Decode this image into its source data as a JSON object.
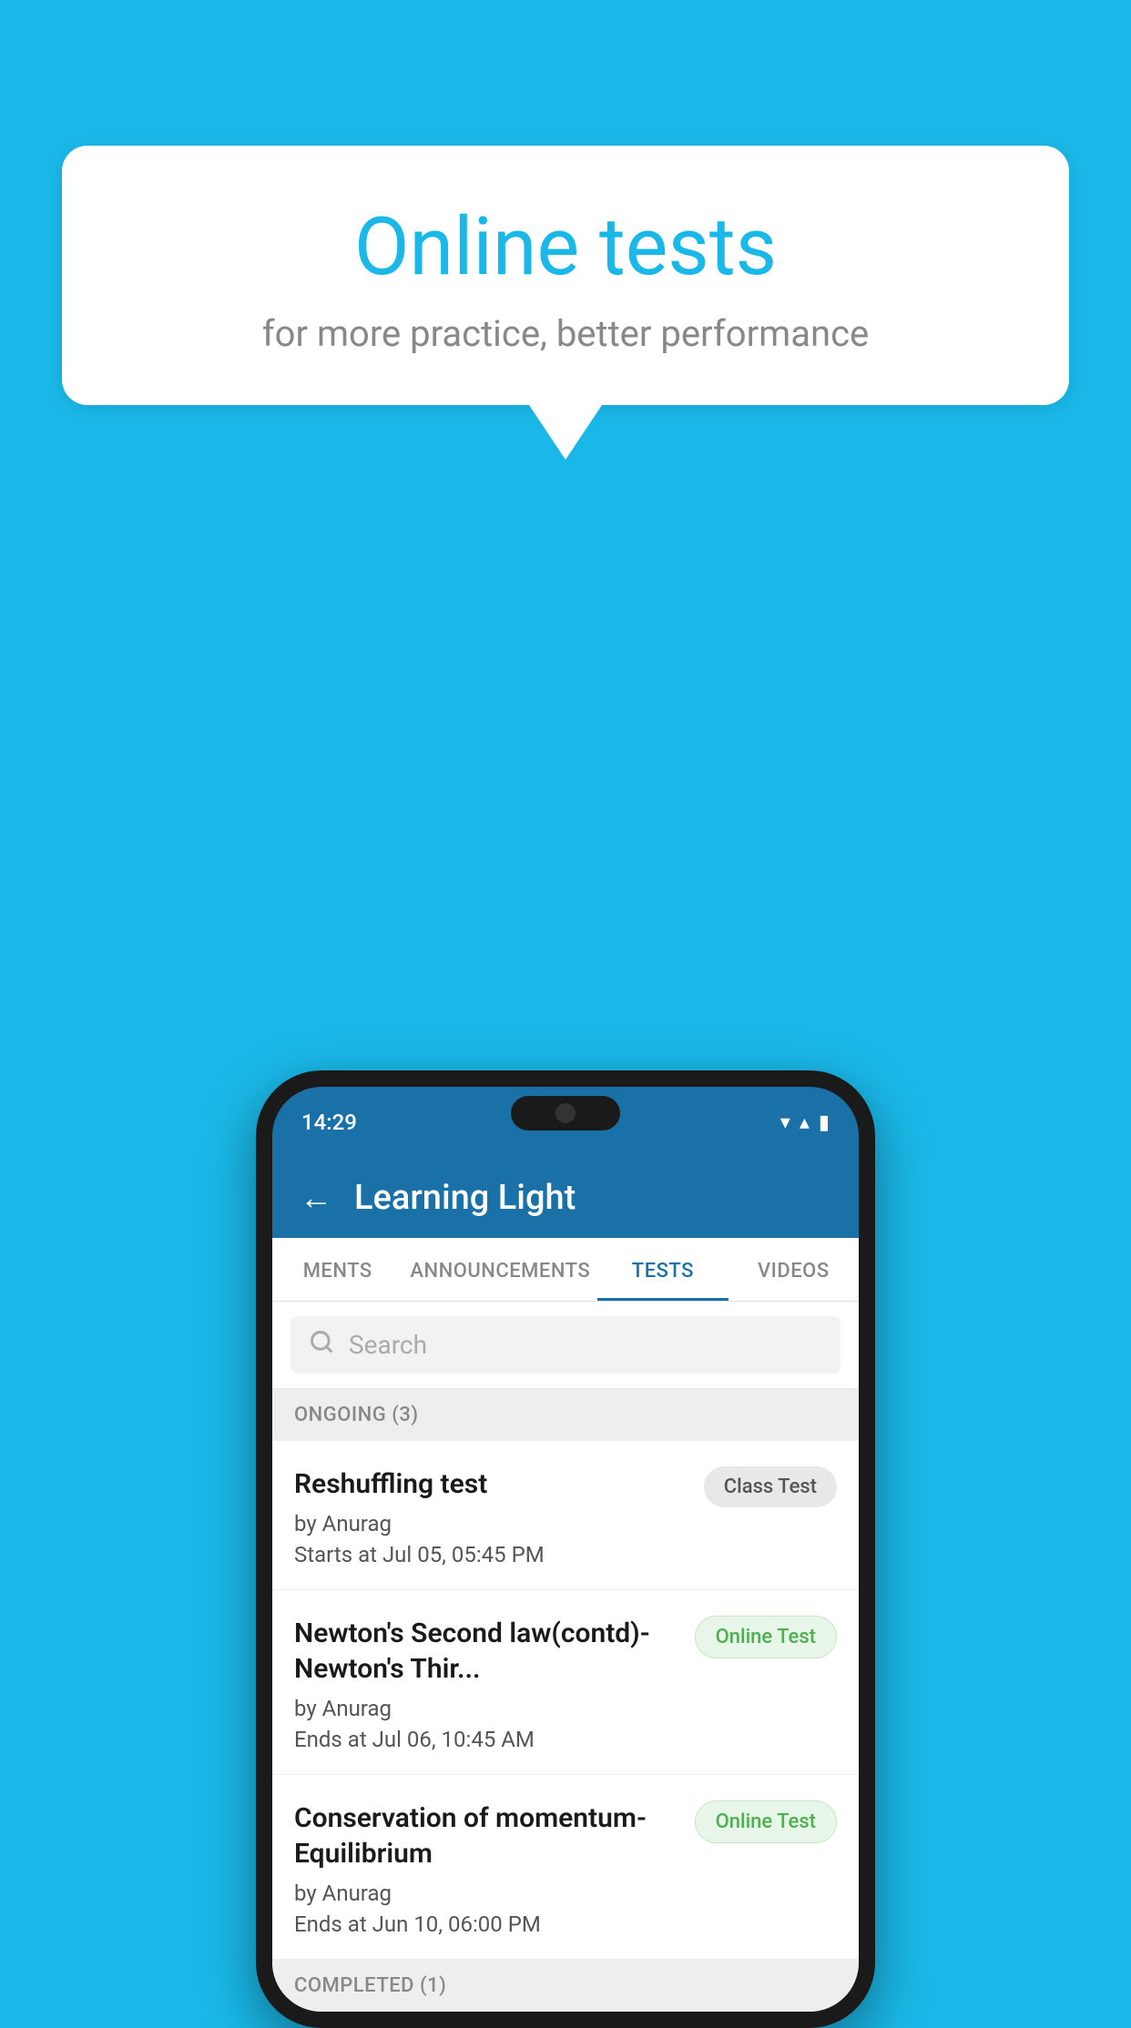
{
  "background": {
    "color": "#1ab8e8"
  },
  "speech_bubble": {
    "title": "Online tests",
    "subtitle": "for more practice, better performance"
  },
  "phone": {
    "status_bar": {
      "time": "14:29",
      "wifi_icon": "▼",
      "signal_icon": "▲",
      "battery_icon": "▮"
    },
    "app_header": {
      "back_label": "←",
      "title": "Learning Light"
    },
    "tabs": [
      {
        "label": "MENTS",
        "active": false
      },
      {
        "label": "ANNOUNCEMENTS",
        "active": false
      },
      {
        "label": "TESTS",
        "active": true
      },
      {
        "label": "VIDEOS",
        "active": false
      }
    ],
    "search": {
      "placeholder": "Search"
    },
    "sections": [
      {
        "title": "ONGOING (3)",
        "items": [
          {
            "title": "Reshuffling test",
            "author": "by Anurag",
            "time_label": "Starts at",
            "time": "Jul 05, 05:45 PM",
            "badge": "Class Test",
            "badge_type": "class"
          },
          {
            "title": "Newton's Second law(contd)-Newton's Thir...",
            "author": "by Anurag",
            "time_label": "Ends at",
            "time": "Jul 06, 10:45 AM",
            "badge": "Online Test",
            "badge_type": "online"
          },
          {
            "title": "Conservation of momentum-Equilibrium",
            "author": "by Anurag",
            "time_label": "Ends at",
            "time": "Jun 10, 06:00 PM",
            "badge": "Online Test",
            "badge_type": "online"
          }
        ]
      },
      {
        "title": "COMPLETED (1)",
        "items": []
      }
    ]
  }
}
